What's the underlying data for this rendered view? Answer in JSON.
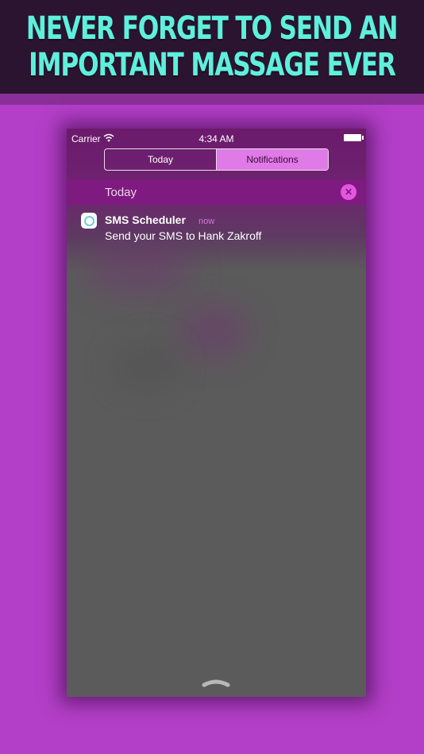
{
  "promo": {
    "line1": "NEVER FORGET TO SEND AN",
    "line2": "IMPORTANT MASSAGE EVER"
  },
  "status_bar": {
    "carrier": "Carrier",
    "time": "4:34 AM",
    "wifi_icon": "wifi-icon",
    "battery_icon": "battery-icon"
  },
  "segments": {
    "today_label": "Today",
    "notifications_label": "Notifications",
    "selected": "Notifications"
  },
  "section": {
    "title": "Today",
    "clear_icon": "close-icon"
  },
  "notification": {
    "app_name": "SMS Scheduler",
    "time": "now",
    "message": "Send your SMS to Hank Zakroff",
    "app_icon": "sms-scheduler-app-icon"
  },
  "colors": {
    "background": "#b33ec7",
    "banner_bg": "#2a1430",
    "banner_text": "#5ef0dc",
    "segment_active": "#e07ae6",
    "section_header": "#7e1a80",
    "clear_button": "#e456e0",
    "panel": "#5b5b5b"
  }
}
